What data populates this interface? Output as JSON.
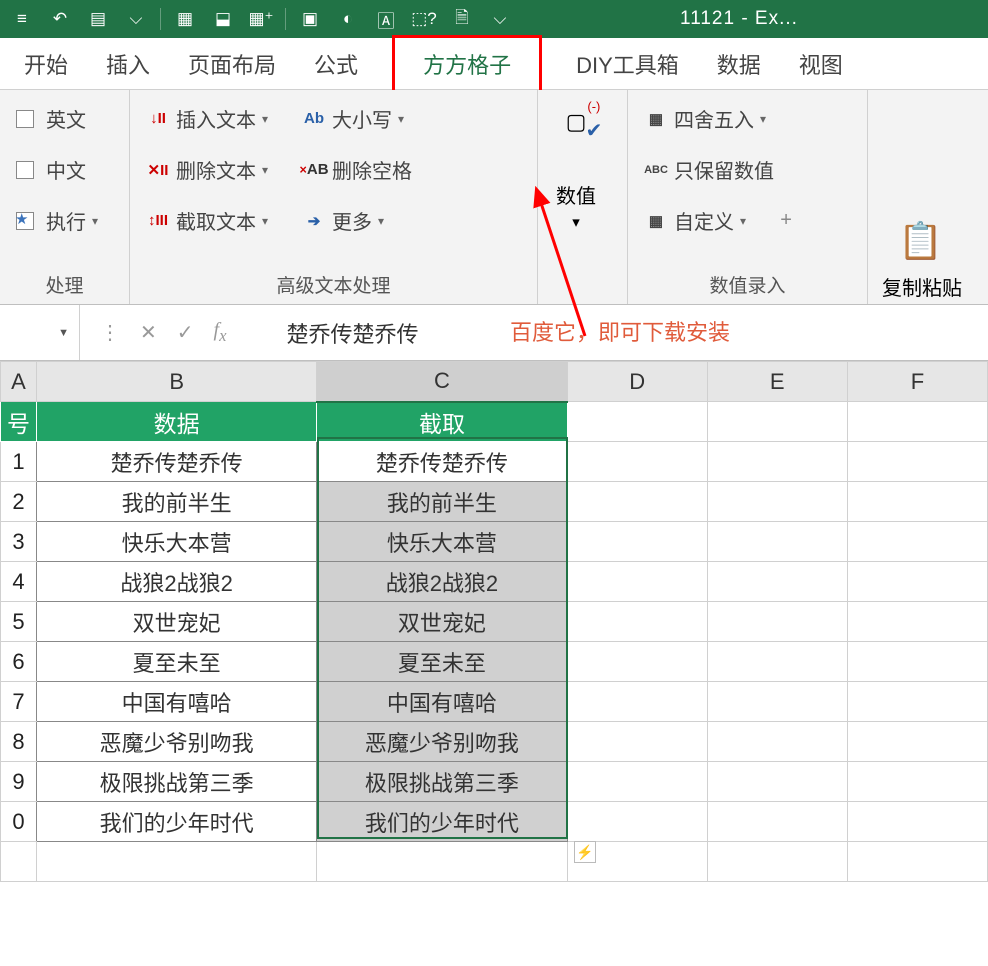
{
  "title": "11121 - Ex...",
  "qat_dropdown": "⌄",
  "tabs": {
    "start": "开始",
    "insert": "插入",
    "pagelayout": "页面布局",
    "formula": "公式",
    "ffgz": "方方格子",
    "diy": "DIY工具箱",
    "data": "数据",
    "view": "视图"
  },
  "ribbon": {
    "group1": {
      "label": "处理",
      "english": "英文",
      "chinese": "中文",
      "execute": "执行"
    },
    "group2": {
      "label": "高级文本处理",
      "insert_text": "插入文本",
      "delete_text": "删除文本",
      "extract_text": "截取文本",
      "case": "大小写",
      "delete_space": "删除空格",
      "more": "更多"
    },
    "group3": {
      "label": "",
      "numeric": "数值"
    },
    "group4": {
      "label": "数值录入",
      "round": "四舍五入",
      "keep_numeric": "只保留数值",
      "custom": "自定义"
    },
    "group5": {
      "paste": "复制粘贴"
    }
  },
  "annotation": "百度它，即可下载安装",
  "formula": {
    "content": "楚乔传楚乔传"
  },
  "columns": [
    "A",
    "B",
    "C",
    "D",
    "E",
    "F"
  ],
  "headers": {
    "a": "号",
    "b": "数据",
    "c": "截取"
  },
  "rows": [
    {
      "a": "1",
      "b": "楚乔传楚乔传",
      "c": "楚乔传楚乔传"
    },
    {
      "a": "2",
      "b": "我的前半生",
      "c": "我的前半生"
    },
    {
      "a": "3",
      "b": "快乐大本营",
      "c": "快乐大本营"
    },
    {
      "a": "4",
      "b": "战狼2战狼2",
      "c": "战狼2战狼2"
    },
    {
      "a": "5",
      "b": "双世宠妃",
      "c": "双世宠妃"
    },
    {
      "a": "6",
      "b": "夏至未至",
      "c": "夏至未至"
    },
    {
      "a": "7",
      "b": "中国有嘻哈",
      "c": "中国有嘻哈"
    },
    {
      "a": "8",
      "b": "恶魔少爷别吻我",
      "c": "恶魔少爷别吻我"
    },
    {
      "a": "9",
      "b": "极限挑战第三季",
      "c": "极限挑战第三季"
    },
    {
      "a": "0",
      "b": "我们的少年时代",
      "c": "我们的少年时代"
    }
  ]
}
